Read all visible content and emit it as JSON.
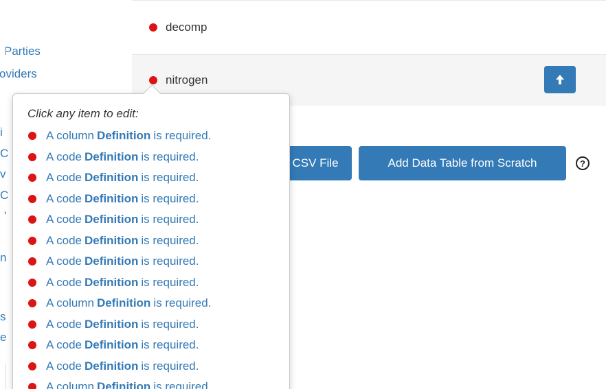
{
  "sidebar": {
    "links": [
      {
        "label": "Parties"
      },
      {
        "label": "oviders"
      }
    ],
    "fragments": [
      "i",
      "C",
      "v",
      "C",
      "'",
      "n",
      "s",
      "e"
    ]
  },
  "rows": [
    {
      "label": "decomp",
      "status_color": "#dc1414"
    },
    {
      "label": "nitrogen",
      "status_color": "#dc1414",
      "action_icon": "arrow-up-icon"
    }
  ],
  "buttons": {
    "csv_label": "CSV File",
    "scratch_label": "Add Data Table from Scratch",
    "help_glyph": "?"
  },
  "popover": {
    "title": "Click any item to edit:",
    "issues": [
      {
        "prefix": "A column",
        "keyword": "Definition",
        "suffix": "is required."
      },
      {
        "prefix": "A code",
        "keyword": "Definition",
        "suffix": "is required."
      },
      {
        "prefix": "A code",
        "keyword": "Definition",
        "suffix": "is required."
      },
      {
        "prefix": "A code",
        "keyword": "Definition",
        "suffix": "is required."
      },
      {
        "prefix": "A code",
        "keyword": "Definition",
        "suffix": "is required."
      },
      {
        "prefix": "A code",
        "keyword": "Definition",
        "suffix": "is required."
      },
      {
        "prefix": "A code",
        "keyword": "Definition",
        "suffix": "is required."
      },
      {
        "prefix": "A code",
        "keyword": "Definition",
        "suffix": "is required."
      },
      {
        "prefix": "A column",
        "keyword": "Definition",
        "suffix": "is required."
      },
      {
        "prefix": "A code",
        "keyword": "Definition",
        "suffix": "is required."
      },
      {
        "prefix": "A code",
        "keyword": "Definition",
        "suffix": "is required."
      },
      {
        "prefix": "A code",
        "keyword": "Definition",
        "suffix": "is required."
      },
      {
        "prefix": "A column",
        "keyword": "Definition",
        "suffix": "is required."
      }
    ]
  },
  "colors": {
    "accent": "#337ab7",
    "error": "#dc1414"
  }
}
